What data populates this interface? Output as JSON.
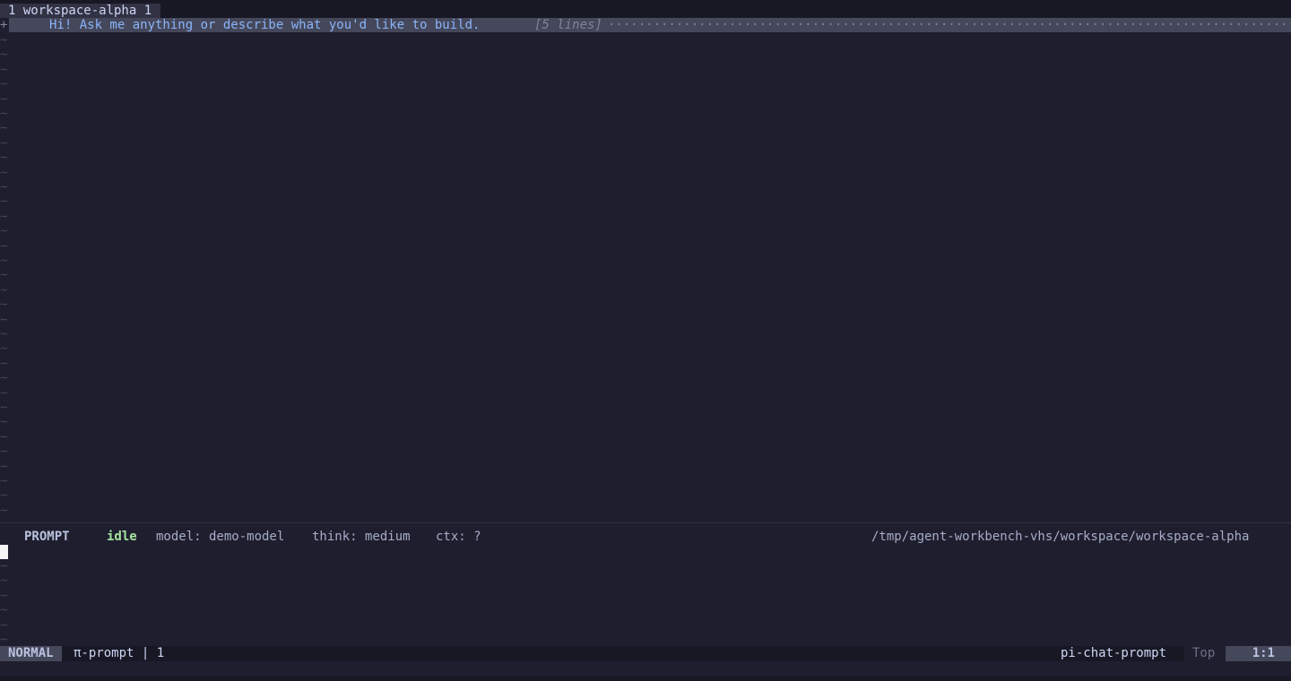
{
  "tabline": {
    "active_tab_label": "1 workspace-alpha 1"
  },
  "fold": {
    "sign": "+",
    "icon": "bot-icon",
    "icon_glyph": "",
    "text": "Hi! Ask me anything or describe what you'd like to build.",
    "line_count": "[5 lines]",
    "filler": "···································································································"
  },
  "empty_line_marker": "~",
  "prompt_bar": {
    "prompt_icon": "",
    "mode_label": "PROMPT",
    "status_icon": "",
    "status": "idle",
    "model": "model: demo-model",
    "think": "think: medium",
    "ctx": "ctx: ?",
    "folder_icon": "",
    "path": "/tmp/agent-workbench-vhs/workspace/workspace-alpha"
  },
  "statusline": {
    "mode": "NORMAL",
    "buffer": "π-prompt | 1",
    "filetype_icon": "",
    "filetype": "pi-chat-prompt",
    "position_label": "Top",
    "location": "1:1"
  },
  "colors": {
    "background": "#1e1e2e",
    "accent_blue": "#89b4fa",
    "status_green": "#a6e3a1",
    "muted": "#7f849c"
  }
}
